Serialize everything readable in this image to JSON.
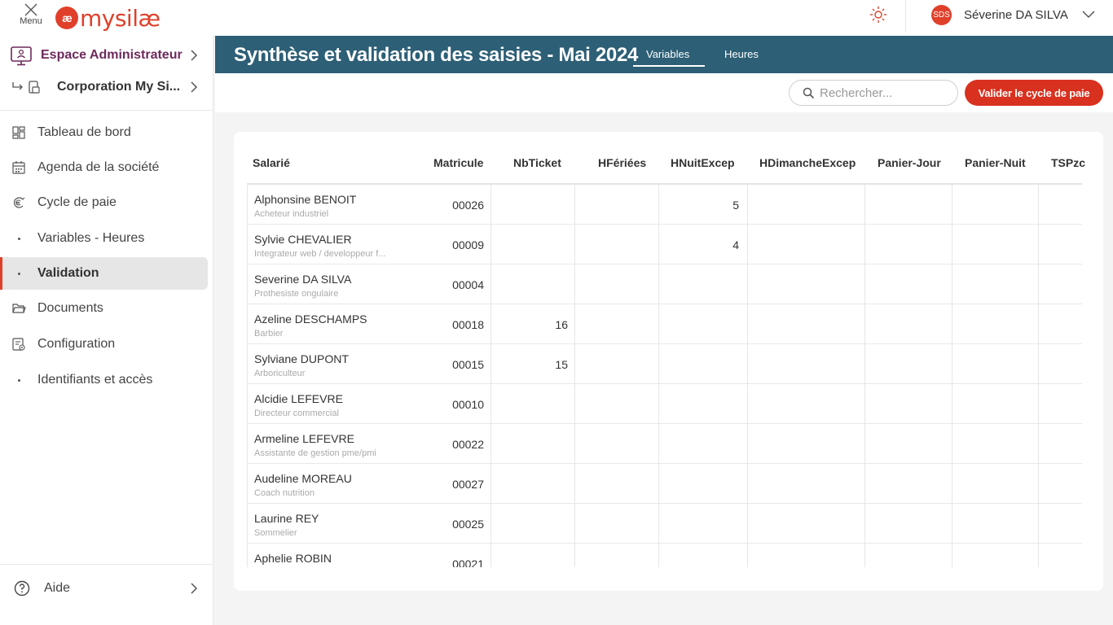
{
  "topbar": {
    "menu_label": "Menu",
    "logo_mark": "æ",
    "logo_text": "mysilæ",
    "user_initials": "SDS",
    "user_name": "Séverine DA SILVA",
    "accent": "#e0402a"
  },
  "sidebar": {
    "admin_label": "Espace Administrateur",
    "corp_label": "Corporation My Si...",
    "items": [
      {
        "label": "Tableau de bord",
        "icon": "dashboard-icon"
      },
      {
        "label": "Agenda de la société",
        "icon": "calendar-icon"
      },
      {
        "label": "Cycle de paie",
        "icon": "euro-cycle-icon"
      },
      {
        "label": "Variables - Heures",
        "icon": "dot"
      },
      {
        "label": "Validation",
        "icon": "dot",
        "active": true
      },
      {
        "label": "Documents",
        "icon": "folder-icon"
      },
      {
        "label": "Configuration",
        "icon": "config-icon"
      },
      {
        "label": "Identifiants et accès",
        "icon": "dot"
      }
    ],
    "help_label": "Aide"
  },
  "header": {
    "title": "Synthèse et validation des saisies - Mai 2024",
    "tabs": [
      {
        "label": "Variables",
        "active": true
      },
      {
        "label": "Heures",
        "active": false
      }
    ],
    "band_color": "#2d5f76"
  },
  "toolbar": {
    "search_placeholder": "Rechercher...",
    "validate_label": "Valider le cycle de paie",
    "validate_color": "#d8311f"
  },
  "table": {
    "columns": [
      "Salarié",
      "Matricule",
      "NbTicket",
      "HFériées",
      "HNuitExcep",
      "HDimancheExcep",
      "Panier-Jour",
      "Panier-Nuit",
      "TSPzc"
    ],
    "rows": [
      {
        "name": "Alphonsine BENOIT",
        "role": "Acheteur industriel",
        "matricule": "00026",
        "nbticket": "",
        "hferiees": "",
        "hnuitexcep": "5"
      },
      {
        "name": "Sylvie CHEVALIER",
        "role": "Integrateur web / developpeur f...",
        "matricule": "00009",
        "nbticket": "",
        "hferiees": "",
        "hnuitexcep": "4"
      },
      {
        "name": "Severine DA SILVA",
        "role": "Prothesiste ongulaire",
        "matricule": "00004",
        "nbticket": "",
        "hferiees": "",
        "hnuitexcep": ""
      },
      {
        "name": "Azeline DESCHAMPS",
        "role": "Barbier",
        "matricule": "00018",
        "nbticket": "16",
        "hferiees": "",
        "hnuitexcep": ""
      },
      {
        "name": "Sylviane DUPONT",
        "role": "Arboriculteur",
        "matricule": "00015",
        "nbticket": "15",
        "hferiees": "",
        "hnuitexcep": ""
      },
      {
        "name": "Alcidie LEFEVRE",
        "role": "Directeur commercial",
        "matricule": "00010",
        "nbticket": "",
        "hferiees": "",
        "hnuitexcep": ""
      },
      {
        "name": "Armeline LEFEVRE",
        "role": "Assistante de gestion pme/pmi",
        "matricule": "00022",
        "nbticket": "",
        "hferiees": "",
        "hnuitexcep": ""
      },
      {
        "name": "Audeline MOREAU",
        "role": "Coach nutrition",
        "matricule": "00027",
        "nbticket": "",
        "hferiees": "",
        "hnuitexcep": ""
      },
      {
        "name": "Laurine REY",
        "role": "Sommelier",
        "matricule": "00025",
        "nbticket": "",
        "hferiees": "",
        "hnuitexcep": ""
      },
      {
        "name": "Aphelie ROBIN",
        "role": "",
        "matricule": "00021",
        "nbticket": "",
        "hferiees": "",
        "hnuitexcep": ""
      }
    ]
  }
}
